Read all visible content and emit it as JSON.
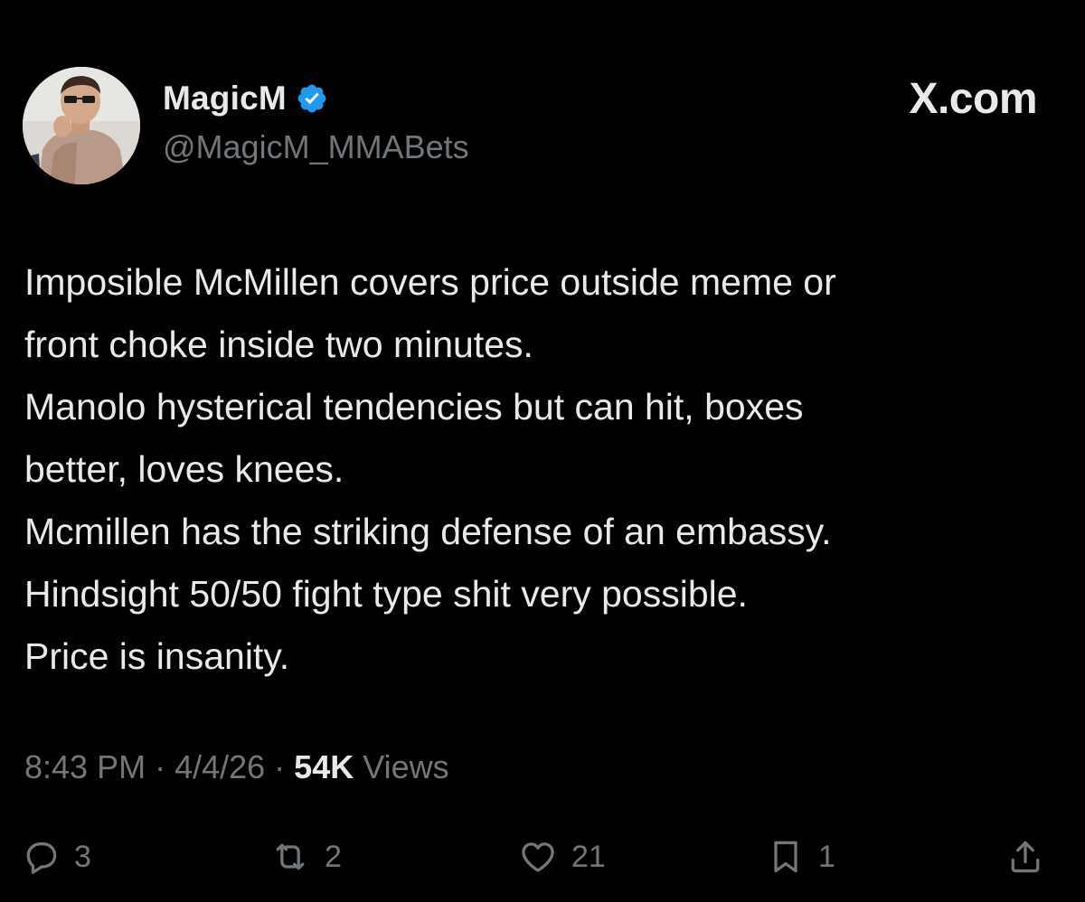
{
  "author": {
    "display_name": "MagicM",
    "handle": "@MagicM_MMABets",
    "verified_icon": "verified-badge-icon",
    "verified_color": "#1d9bf0"
  },
  "brand": {
    "label": "X.com"
  },
  "tweet": {
    "lines": [
      "Imposible McMillen covers price outside meme or",
      "front choke inside two minutes.",
      "Manolo hysterical tendencies but can hit, boxes",
      "better, loves knees.",
      "Mcmillen has the striking defense of an embassy.",
      "Hindsight 50/50 fight type shit very possible.",
      "Price is insanity."
    ]
  },
  "meta": {
    "time": "8:43 PM",
    "separator1": " · ",
    "date": "4/4/26",
    "separator2": " · ",
    "views_count": "54K",
    "views_label": " Views"
  },
  "actions": {
    "reply": {
      "icon": "reply-icon",
      "count": "3"
    },
    "retweet": {
      "icon": "retweet-icon",
      "count": "2"
    },
    "like": {
      "icon": "heart-icon",
      "count": "21"
    },
    "bookmark": {
      "icon": "bookmark-icon",
      "count": "1"
    },
    "share": {
      "icon": "share-icon"
    }
  },
  "colors": {
    "background": "#000000",
    "text_primary": "#e7e9ea",
    "text_secondary": "#71767b"
  }
}
